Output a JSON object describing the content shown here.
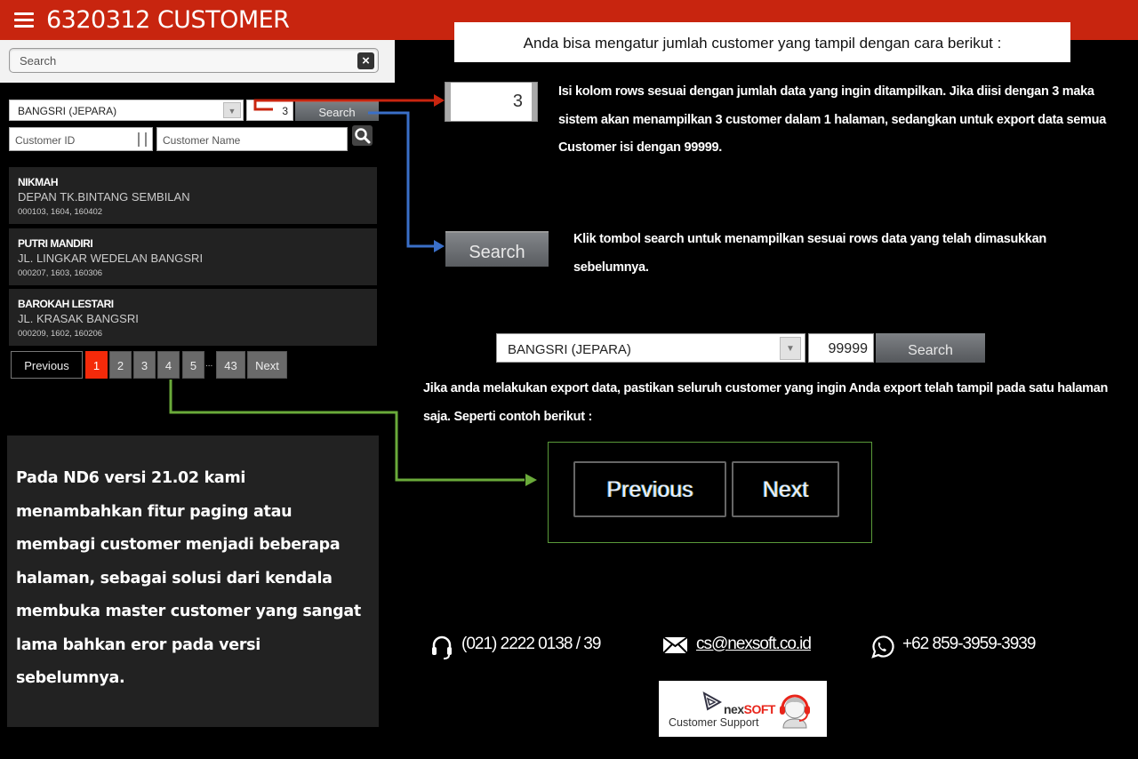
{
  "app": {
    "title": "6320312 CUSTOMER",
    "menu_icon": "hamburger-menu-icon"
  },
  "search": {
    "placeholder": "Search",
    "clear_icon": "close-icon"
  },
  "filters": {
    "branch": "BANGSRI (JEPARA)",
    "rows": "3",
    "search_label": "Search",
    "customer_id_placeholder": "Customer ID",
    "customer_name_placeholder": "Customer Name"
  },
  "customers": [
    {
      "name": "NIKMAH",
      "address": "DEPAN TK.BINTANG SEMBILAN",
      "codes": "000103, 1604, 160402"
    },
    {
      "name": "PUTRI MANDIRI",
      "address": "JL. LINGKAR WEDELAN BANGSRI",
      "codes": "000207, 1603, 160306"
    },
    {
      "name": "BAROKAH LESTARI",
      "address": "JL. KRASAK BANGSRI",
      "codes": "000209, 1602, 160206"
    }
  ],
  "pagination": {
    "previous": "Previous",
    "pages": [
      "1",
      "2",
      "3",
      "4",
      "5"
    ],
    "ellipsis": "...",
    "last_page": "43",
    "next": "Next",
    "current": "1"
  },
  "info": {
    "text": "Pada ND6 versi 21.02 kami menambahkan fitur paging atau membagi customer menjadi beberapa halaman, sebagai solusi dari kendala membuka master customer yang sangat lama bahkan eror pada versi sebelumnya."
  },
  "tutorial": {
    "banner": "Anda bisa mengatur jumlah customer yang tampil dengan cara berikut :",
    "rows_example": "3",
    "rows_desc": "Isi kolom rows sesuai dengan jumlah data yang ingin ditampilkan. Jika diisi dengan 3 maka sistem akan menampilkan 3 customer dalam 1 halaman, sedangkan untuk export data semua Customer isi dengan 99999.",
    "search_example": "Search",
    "search_desc": "Klik tombol search untuk menampilkan sesuai rows data yang telah dimasukkan sebelumnya.",
    "export_branch": "BANGSRI (JEPARA)",
    "export_rows": "99999",
    "export_search": "Search",
    "export_desc": "Jika anda melakukan export data, pastikan seluruh customer yang ingin Anda export telah tampil pada satu halaman saja. Seperti contoh berikut :",
    "pager_previous": "Previous",
    "pager_next": "Next"
  },
  "contact": {
    "phone": "(021) 2222 0138 / 39",
    "email": "cs@nexsoft.co.id",
    "whatsapp": "+62 859-3959-3939"
  },
  "logo": {
    "brand_prefix": "nex",
    "brand_suffix": "SOFT",
    "subtitle": "Customer Support"
  },
  "colors": {
    "header": "#c8250f",
    "active_page": "#f52a0a",
    "arrow_rows": "#c8250f",
    "arrow_search": "#3a6fc8",
    "arrow_pager": "#6aaa3a"
  }
}
